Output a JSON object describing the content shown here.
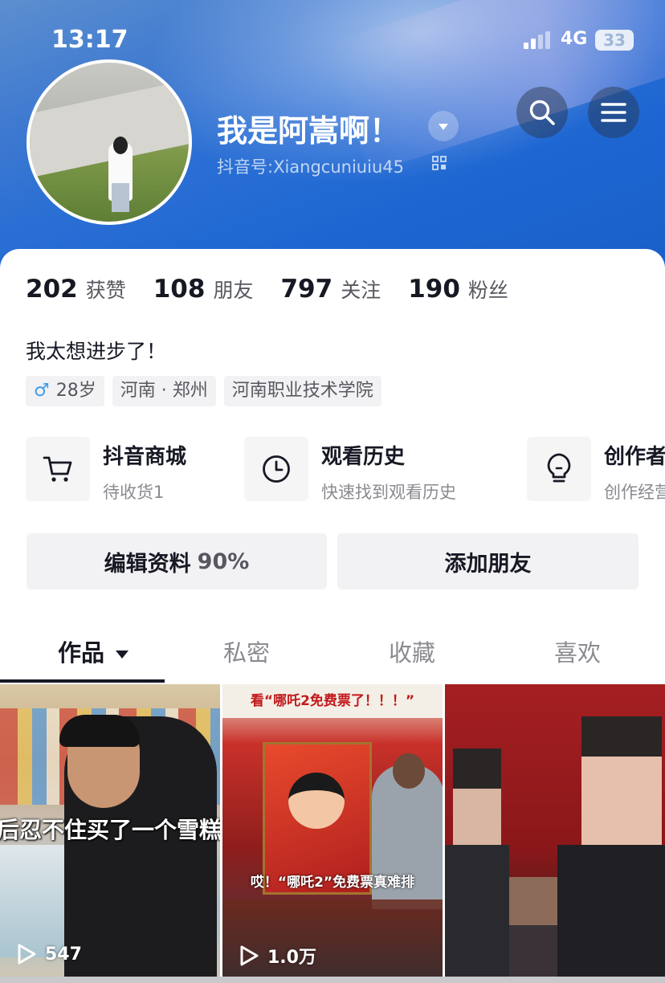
{
  "status_bar": {
    "time": "13:17",
    "network": "4G",
    "battery": "33"
  },
  "profile": {
    "nickname": "我是阿嵩啊！",
    "douyin_id": "抖音号:Xiangcuniuiu45",
    "bio": "我太想进步了！",
    "tags": {
      "age": "28岁",
      "location": "河南 · 郑州",
      "school": "河南职业技术学院"
    }
  },
  "stats": {
    "likes_value": "202",
    "likes_label": "获赞",
    "friends_value": "108",
    "friends_label": "朋友",
    "following_value": "797",
    "following_label": "关注",
    "fans_value": "190",
    "fans_label": "粉丝"
  },
  "shortcuts": {
    "mall_title": "抖音商城",
    "mall_sub": "待收货1",
    "history_title": "观看历史",
    "history_sub": "快速找到观看历史",
    "creator_title": "创作者",
    "creator_sub": "创作经营"
  },
  "actions": {
    "edit_label": "编辑资料",
    "edit_percent": "90%",
    "add_friend_label": "添加朋友"
  },
  "tabs": {
    "works": "作品",
    "private": "私密",
    "favorites": "收藏",
    "likes": "喜欢"
  },
  "videos": {
    "v1_caption": "后忍不住买了一个雪糕",
    "v1_plays": "547",
    "v2_title": "看“哪吒2免费票了！！！”",
    "v2_sub": "哎！“哪吒2”免费票真难排",
    "v2_plays": "1.0万"
  },
  "icons": {
    "search": "search-icon",
    "menu": "menu-icon",
    "dropdown": "chevron-down-icon",
    "qr": "qr-code-icon",
    "cart": "cart-icon",
    "clock": "clock-icon",
    "bulb": "lightbulb-icon",
    "play": "play-icon"
  },
  "colors": {
    "header_blue": "#1d66d2",
    "text_primary": "#161823",
    "text_secondary": "#57585f",
    "male_blue": "#3d9be9"
  }
}
